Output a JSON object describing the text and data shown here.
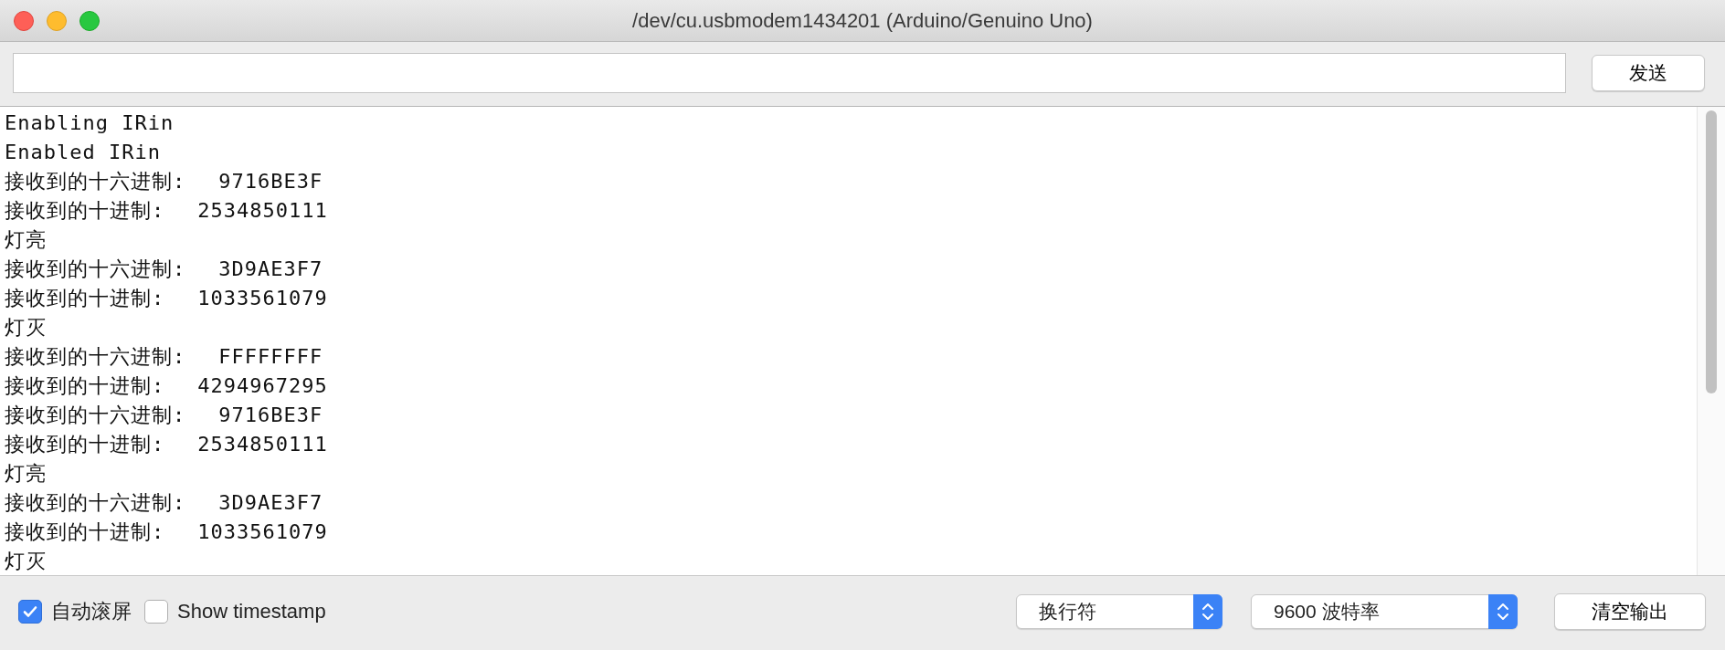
{
  "window": {
    "title": "/dev/cu.usbmodem1434201 (Arduino/Genuino Uno)"
  },
  "send": {
    "button": "发送"
  },
  "output": {
    "lines": [
      {
        "kind": "text",
        "text": "Enabling IRin"
      },
      {
        "kind": "text",
        "text": "Enabled IRin"
      },
      {
        "kind": "reading",
        "label": "接收到的十六进制:",
        "value": "9716BE3F"
      },
      {
        "kind": "reading",
        "label": "接收到的十进制:",
        "value": "2534850111"
      },
      {
        "kind": "text",
        "text": "灯亮"
      },
      {
        "kind": "reading",
        "label": "接收到的十六进制:",
        "value": "3D9AE3F7"
      },
      {
        "kind": "reading",
        "label": "接收到的十进制:",
        "value": "1033561079"
      },
      {
        "kind": "text",
        "text": "灯灭"
      },
      {
        "kind": "reading",
        "label": "接收到的十六进制:",
        "value": "FFFFFFFF"
      },
      {
        "kind": "reading",
        "label": "接收到的十进制:",
        "value": "4294967295"
      },
      {
        "kind": "reading",
        "label": "接收到的十六进制:",
        "value": "9716BE3F"
      },
      {
        "kind": "reading",
        "label": "接收到的十进制:",
        "value": "2534850111"
      },
      {
        "kind": "text",
        "text": "灯亮"
      },
      {
        "kind": "reading",
        "label": "接收到的十六进制:",
        "value": "3D9AE3F7"
      },
      {
        "kind": "reading",
        "label": "接收到的十进制:",
        "value": "1033561079"
      },
      {
        "kind": "text",
        "text": "灯灭"
      }
    ]
  },
  "footer": {
    "autoscroll": {
      "label": "自动滚屏",
      "checked": true
    },
    "timestamp": {
      "label": "Show timestamp",
      "checked": false
    },
    "line_ending": "换行符",
    "baud_rate": "9600 波特率",
    "clear_button": "清空输出"
  }
}
